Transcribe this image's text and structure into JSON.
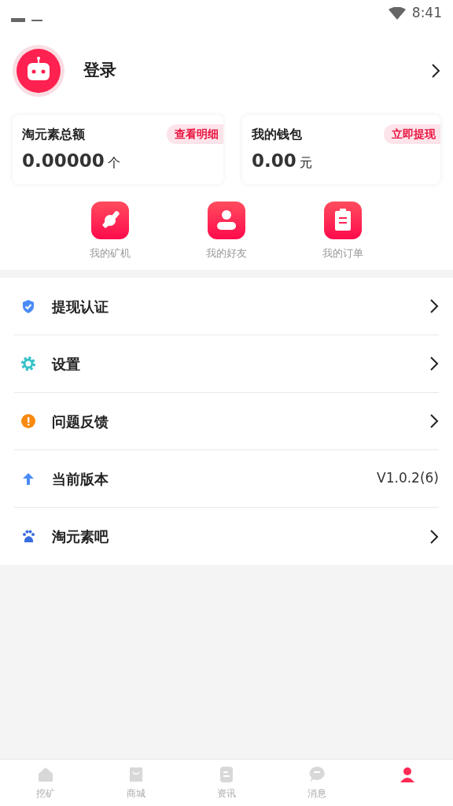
{
  "status_bar": {
    "time": "8:41"
  },
  "profile": {
    "name": "登录"
  },
  "cards": [
    {
      "title": "淘元素总额",
      "action": "查看明细",
      "amount": "0.00000",
      "unit": "个"
    },
    {
      "title": "我的钱包",
      "action": "立即提现",
      "amount": "0.00",
      "unit": "元"
    }
  ],
  "shortcuts": [
    {
      "kind": "miner",
      "label": "我的矿机"
    },
    {
      "kind": "friends",
      "label": "我的好友"
    },
    {
      "kind": "orders",
      "label": "我的订单"
    }
  ],
  "menu": [
    {
      "kind": "shield",
      "label": "提现认证"
    },
    {
      "kind": "gear",
      "label": "设置"
    },
    {
      "kind": "alert",
      "label": "问题反馈"
    },
    {
      "kind": "arrow",
      "label": "当前版本",
      "value": "V1.0.2(6)"
    },
    {
      "kind": "paw",
      "label": "淘元素吧"
    }
  ],
  "tabs": [
    {
      "kind": "home",
      "label": "挖矿",
      "selected": false
    },
    {
      "kind": "bag",
      "label": "商城",
      "selected": false
    },
    {
      "kind": "doc",
      "label": "资讯",
      "selected": false
    },
    {
      "kind": "chat",
      "label": "消息",
      "selected": false
    },
    {
      "kind": "person",
      "selected": true
    }
  ]
}
